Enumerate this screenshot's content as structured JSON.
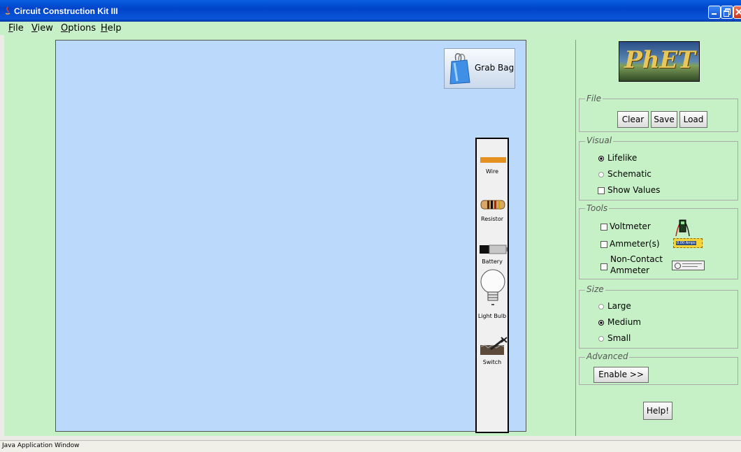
{
  "window": {
    "title": "Circuit Construction Kit III"
  },
  "menu": [
    {
      "label": "File",
      "mnemonic": "F",
      "rest": "ile"
    },
    {
      "label": "View",
      "mnemonic": "V",
      "rest": "iew"
    },
    {
      "label": "Options",
      "mnemonic": "O",
      "rest": "ptions"
    },
    {
      "label": "Help",
      "mnemonic": "H",
      "rest": "elp"
    }
  ],
  "canvas": {
    "grab_bag_label": "Grab Bag",
    "toolbox": [
      {
        "label": "Wire",
        "icon": "wire-icon"
      },
      {
        "label": "Resistor",
        "icon": "resistor-icon"
      },
      {
        "label": "Battery",
        "icon": "battery-icon"
      },
      {
        "label": "Light Bulb",
        "icon": "light-bulb-icon"
      },
      {
        "label": "Switch",
        "icon": "switch-icon"
      }
    ]
  },
  "side": {
    "logo": "PhET",
    "file": {
      "title": "File",
      "clear": "Clear",
      "save": "Save",
      "load": "Load"
    },
    "visual": {
      "title": "Visual",
      "lifelike": "Lifelike",
      "schematic": "Schematic",
      "show_values": "Show Values",
      "selected": "Lifelike"
    },
    "tools": {
      "title": "Tools",
      "voltmeter": "Voltmeter",
      "ammeter": "Ammeter(s)",
      "noncontact_1": "Non-Contact",
      "noncontact_2": "Ammeter",
      "ammeter_readout": "0.00 Amps"
    },
    "size": {
      "title": "Size",
      "large": "Large",
      "medium": "Medium",
      "small": "Small",
      "selected": "Medium"
    },
    "advanced": {
      "title": "Advanced",
      "enable": "Enable >>"
    },
    "help": "Help!"
  },
  "status": "Java Application Window",
  "colors": {
    "panel_bg": "#c6f1c6",
    "canvas_bg": "#bbd9fb",
    "titlebar": "#0043c8"
  }
}
